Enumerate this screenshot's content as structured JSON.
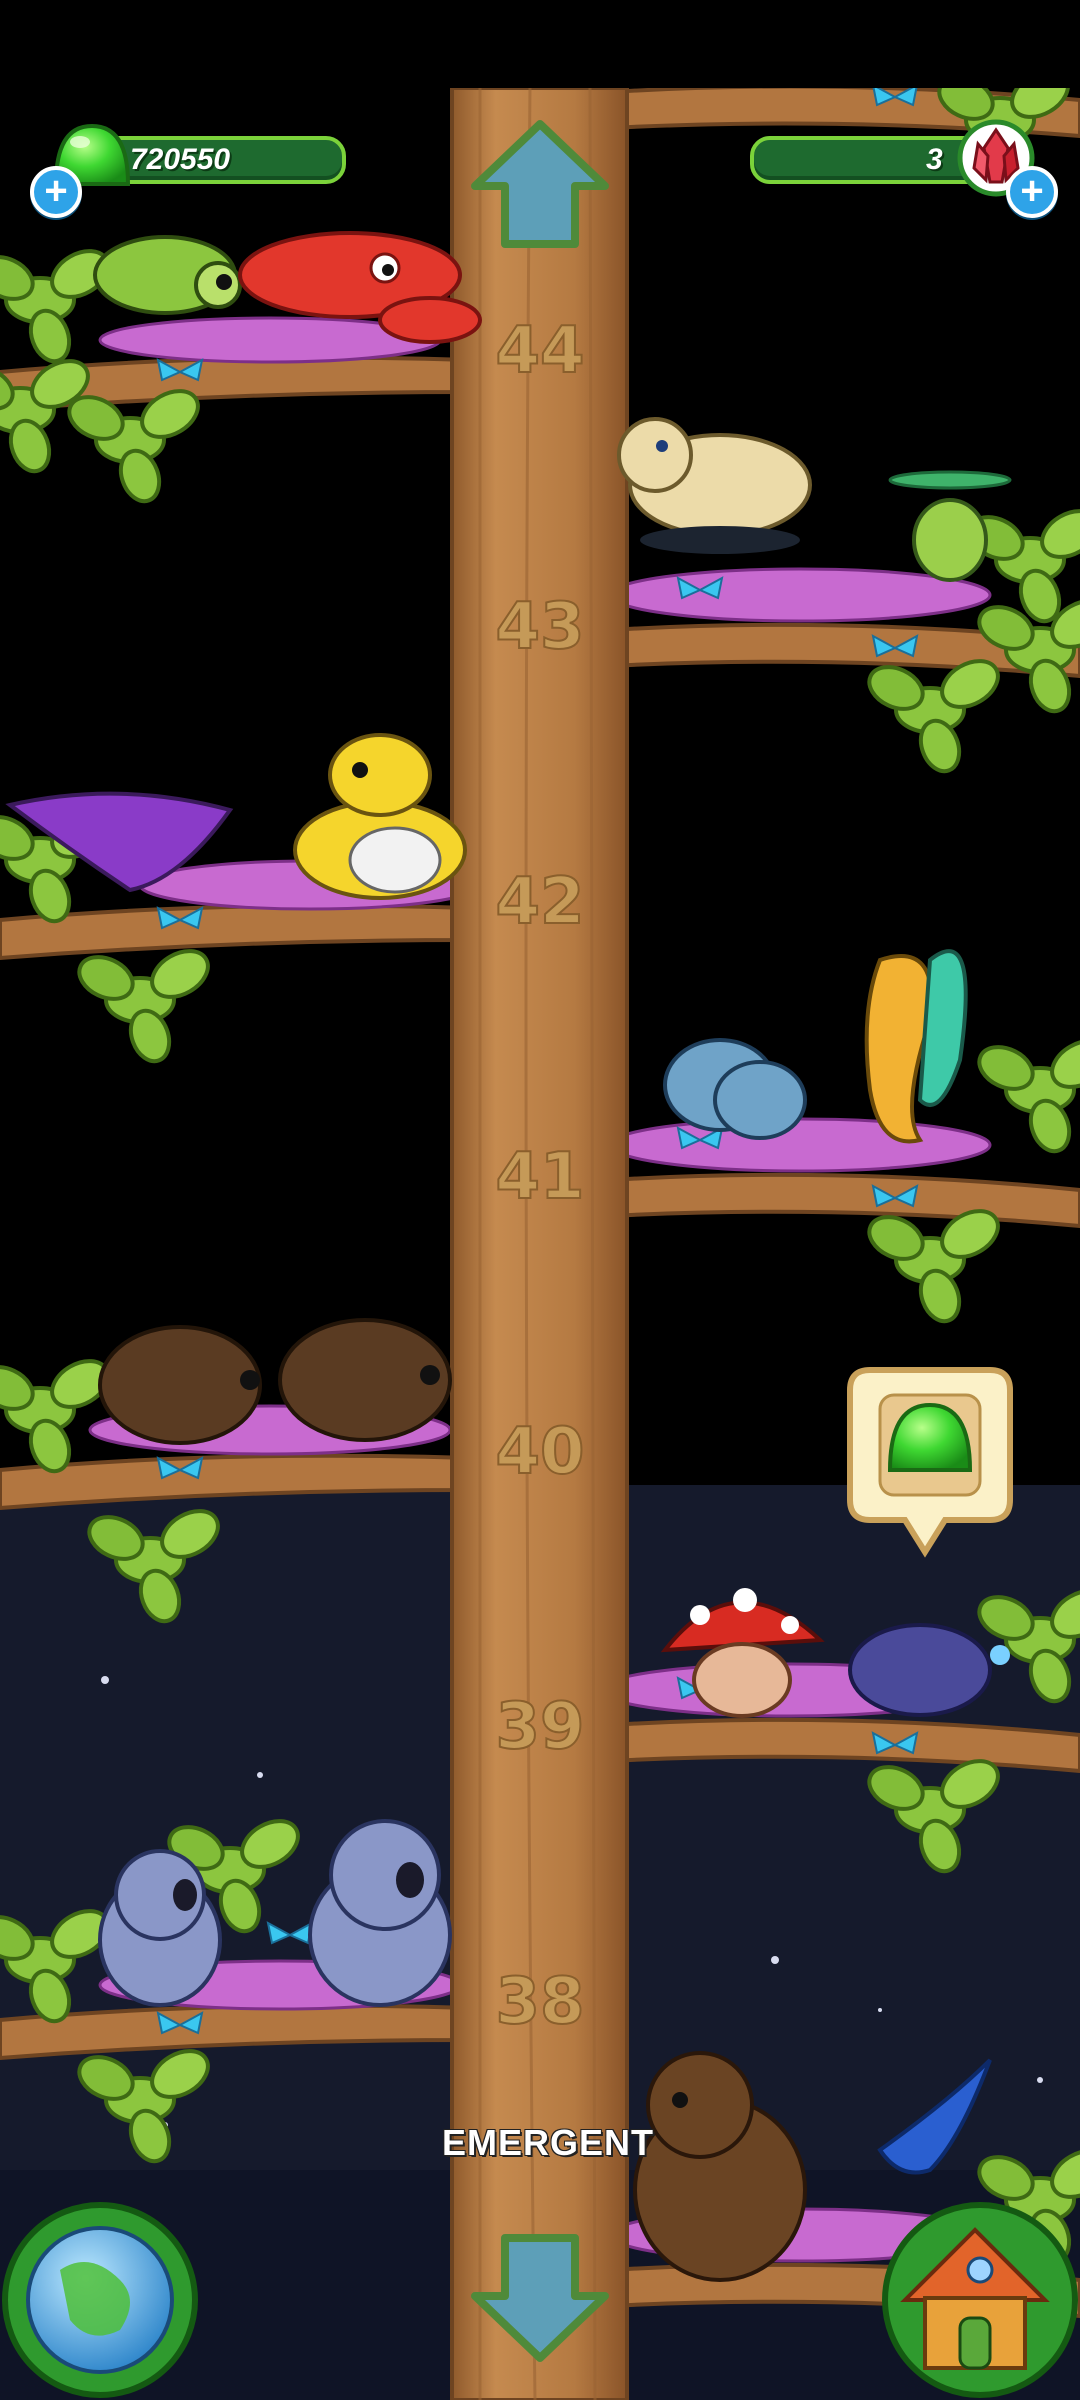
{
  "currency": {
    "jelly_count": "720550",
    "gem_count": "3",
    "jelly_icon": "green-jelly-icon",
    "gem_icon": "red-crystal-icon"
  },
  "navigation": {
    "up_arrow_icon": "arrow-up-icon",
    "down_arrow_icon": "arrow-down-icon",
    "world_icon": "globe-icon",
    "home_icon": "house-icon"
  },
  "tree": {
    "floors": [
      "44",
      "43",
      "42",
      "41",
      "40",
      "39",
      "38"
    ],
    "level_label": "EMERGENT"
  },
  "collect_bubble": {
    "icon": "green-jelly-icon"
  },
  "colors": {
    "trunk": "#b97d45",
    "leaf": "#8cc63f",
    "perch": "#c86ad0",
    "hud_green": "#1e6a2f",
    "night_sky": "#151a2c"
  }
}
